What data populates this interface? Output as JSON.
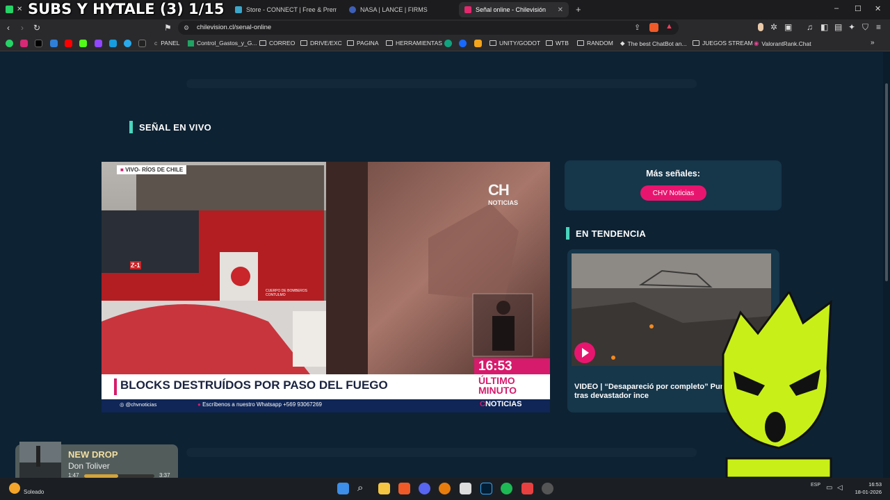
{
  "overlay_title": "SUBS Y HYTALE (3) 1/15",
  "tabs": [
    {
      "label": "Store - CONNECT | Free & Premium",
      "color": "#3aa6c9"
    },
    {
      "label": "NASA | LANCE | FIRMS",
      "color": "#3d5fb8"
    },
    {
      "label": "Señal online - Chilevisión",
      "color": "#e3286e"
    }
  ],
  "tab_close": "✕",
  "new_tab": "+",
  "window_controls": {
    "minimize": "–",
    "maximize": "☐",
    "close": "✕"
  },
  "url": "chilevision.cl/senal-online",
  "bookmarks": [
    "PANEL",
    "Control_Gastos_y_G...",
    "CORREO",
    "DRIVE/EXC",
    "PAGINA",
    "HERRAMIENTAS",
    "UNITY/GODOT",
    "WTB",
    "RANDOM",
    "The best ChatBot an...",
    "JUEGOS STREAM",
    "ValorantRank.Chat"
  ],
  "page": {
    "live_title": "SEÑAL EN VIVO",
    "more_label": "Más señales:",
    "chv_button": "CHV Noticias",
    "trend_title": "EN TENDENCIA",
    "trend_caption": "VIDEO | “Desapareció por completo” Punta de Parra tras devastador ince"
  },
  "video": {
    "live_tag": "VIVO- RÍOS DE CHILE",
    "logo_top": "CH",
    "logo_bottom": "NOTICIAS",
    "time": "16:53",
    "headline": "BLOCKS DESTRUÍDOS POR PASO DEL FUEGO",
    "ultimo": "ÚLTIMO",
    "minuto": "MINUTO",
    "handle": "@chvnoticias",
    "whatsapp": "Escríbenos a nuestro Whatsapp +569 93067269",
    "brand": "NOTICIAS",
    "truck_text": "CUERPO DE BOMBEROS CONTULMO",
    "truck_unit": "Z-1"
  },
  "music": {
    "tag": "NEW DROP",
    "artist": "Don Toliver",
    "elapsed": "1:47",
    "total": "3:37",
    "progress": 0.49
  },
  "taskbar": {
    "weather": "Soleado",
    "lang": "ESP",
    "time": "16:53",
    "date": "18-01-2026"
  },
  "colors": {
    "page_bg": "#0d2233",
    "card": "#16364a",
    "accent": "#4ad4bd",
    "chv_pink": "#e8156f"
  }
}
